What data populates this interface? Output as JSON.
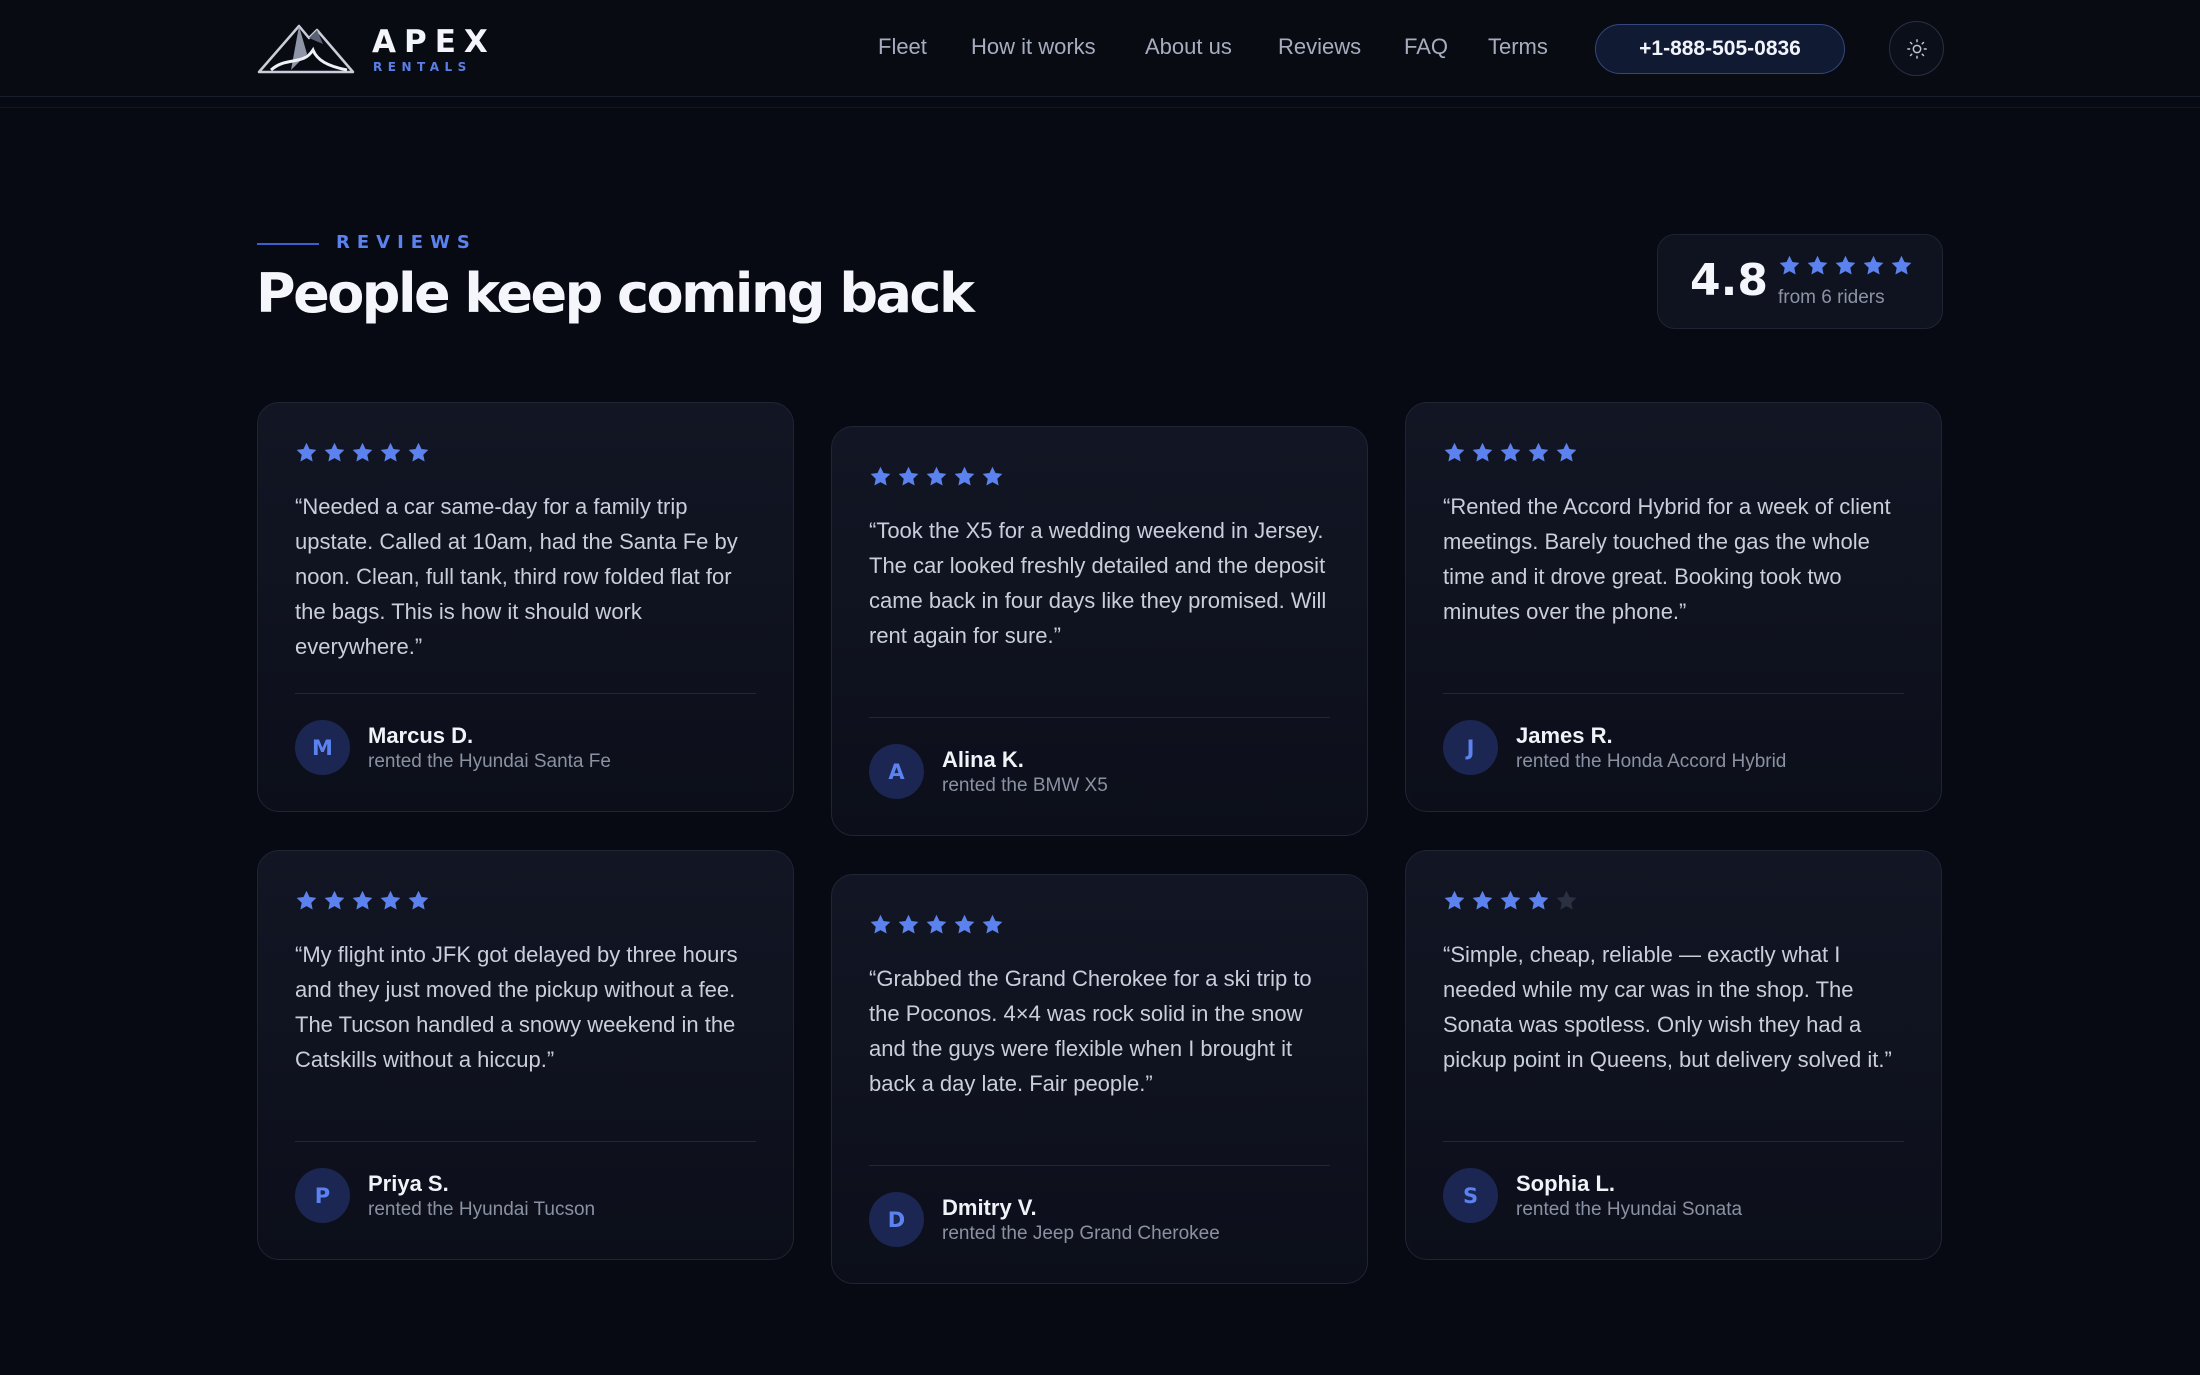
{
  "brand": {
    "name": "APEX",
    "tagline": "RENTALS"
  },
  "nav": {
    "links": [
      "Fleet",
      "How it works",
      "About us",
      "Reviews",
      "FAQ",
      "Terms"
    ],
    "phone": "+1-888-505-0836",
    "theme_icon": "sun-icon"
  },
  "section": {
    "eyebrow": "REVIEWS",
    "title": "People keep coming back",
    "rating": {
      "score": "4.8",
      "stars": 5,
      "sub": "from 6 riders"
    }
  },
  "colors": {
    "accent": "#5b82ee",
    "star_empty": "#2a3040",
    "background": "#070a12"
  },
  "reviews": [
    {
      "stars": 5,
      "quote": "“Needed a car same-day for a family trip upstate. Called at 10am, had the Santa Fe by noon. Clean, full tank, third row folded flat for the bags. This is how it should work everywhere.”",
      "initial": "M",
      "name": "Marcus D.",
      "car": "rented the Hyundai Santa Fe"
    },
    {
      "stars": 5,
      "quote": "“Took the X5 for a wedding weekend in Jersey. The car looked freshly detailed and the deposit came back in four days like they promised. Will rent again for sure.”",
      "initial": "A",
      "name": "Alina K.",
      "car": "rented the BMW X5"
    },
    {
      "stars": 5,
      "quote": "“Rented the Accord Hybrid for a week of client meetings. Barely touched the gas the whole time and it drove great. Booking took two minutes over the phone.”",
      "initial": "J",
      "name": "James R.",
      "car": "rented the Honda Accord Hybrid"
    },
    {
      "stars": 5,
      "quote": "“My flight into JFK got delayed by three hours and they just moved the pickup without a fee. The Tucson handled a snowy weekend in the Catskills without a hiccup.”",
      "initial": "P",
      "name": "Priya S.",
      "car": "rented the Hyundai Tucson"
    },
    {
      "stars": 5,
      "quote": "“Grabbed the Grand Cherokee for a ski trip to the Poconos. 4×4 was rock solid in the snow and the guys were flexible when I brought it back a day late. Fair people.”",
      "initial": "D",
      "name": "Dmitry V.",
      "car": "rented the Jeep Grand Cherokee"
    },
    {
      "stars": 4,
      "quote": "“Simple, cheap, reliable — exactly what I needed while my car was in the shop. The Sonata was spotless. Only wish they had a pickup point in Queens, but delivery solved it.”",
      "initial": "S",
      "name": "Sophia L.",
      "car": "rented the Hyundai Sonata"
    }
  ]
}
